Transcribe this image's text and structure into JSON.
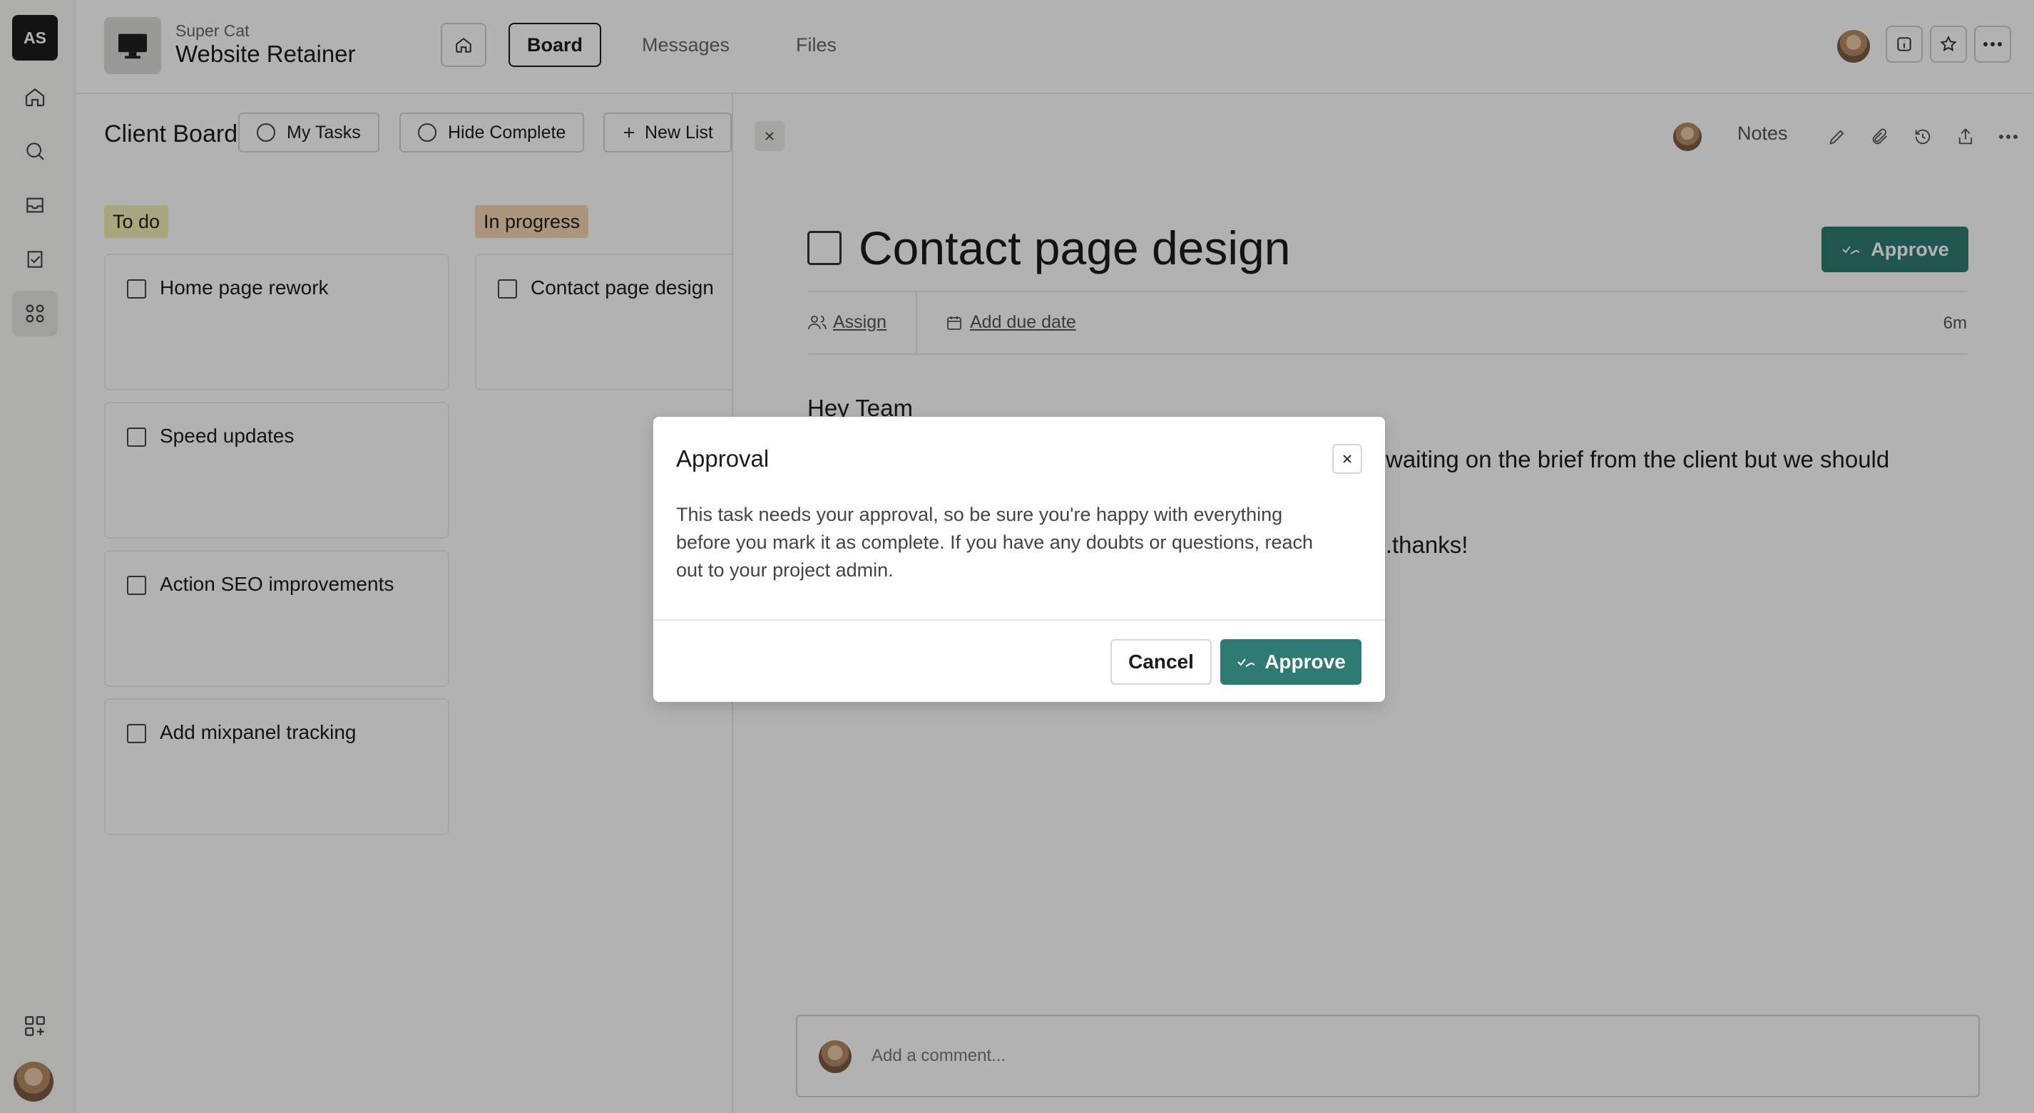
{
  "rail": {
    "workspace_initials": "AS",
    "items": [
      {
        "icon": "home-icon"
      },
      {
        "icon": "search-icon"
      },
      {
        "icon": "inbox-icon"
      },
      {
        "icon": "tasks-icon"
      },
      {
        "icon": "apps-icon",
        "active": true
      }
    ],
    "bottom_icon": "add-app-icon"
  },
  "header": {
    "project_parent": "Super Cat",
    "project_name": "Website Retainer",
    "tabs": [
      {
        "label": "Board",
        "active": true
      },
      {
        "label": "Messages"
      },
      {
        "label": "Files"
      }
    ]
  },
  "board": {
    "title": "Client Board",
    "filters": {
      "my_tasks": "My Tasks",
      "hide_complete": "Hide Complete",
      "new_list": "New List"
    },
    "columns": [
      {
        "label": "To do",
        "color": "#f1eeb5",
        "cards": [
          "Home page rework",
          "Speed updates",
          "Action SEO improvements",
          "Add mixpanel tracking"
        ]
      },
      {
        "label": "In progress",
        "color": "#f6d6b3",
        "cards": [
          "Contact page design"
        ]
      }
    ]
  },
  "task": {
    "notes_label": "Notes",
    "title": "Contact page design",
    "approve_label": "Approve",
    "assign_label": "Assign",
    "due_label": "Add due date",
    "time_ago": "6m",
    "body_line1": "Hey Team",
    "body_line2": "waiting on the brief from the client but we should",
    "body_line3": "s ..thanks!",
    "comment_placeholder": "Add a comment..."
  },
  "modal": {
    "title": "Approval",
    "body": "This task needs your approval, so be sure you're happy with everything before you mark it as complete. If you have any doubts or questions, reach out to your project admin.",
    "cancel_label": "Cancel",
    "approve_label": "Approve"
  },
  "colors": {
    "accent": "#2f7a73",
    "overlay": "rgba(0,0,0,0.30)"
  }
}
